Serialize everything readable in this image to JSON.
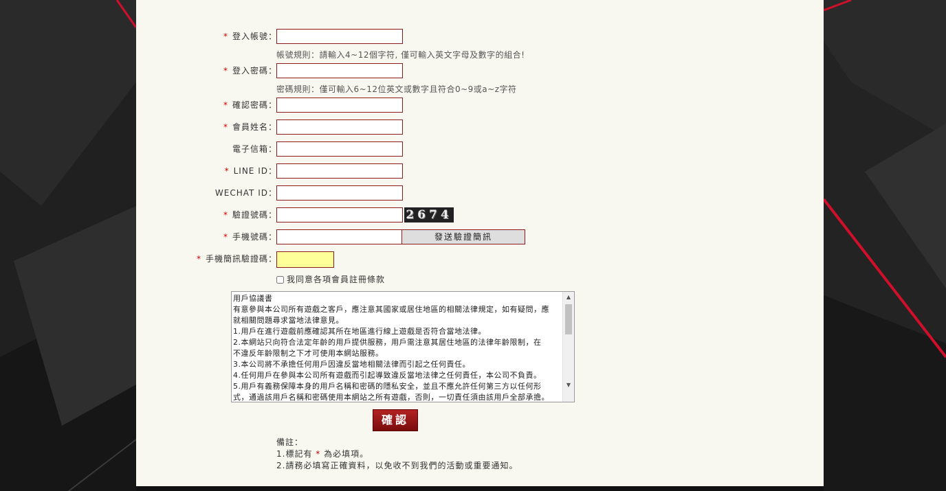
{
  "form": {
    "fields": [
      {
        "label": "登入帳號",
        "required": true,
        "value": ""
      },
      {
        "label": "登入密碼",
        "required": true,
        "value": ""
      },
      {
        "label": "確認密碼",
        "required": true,
        "value": ""
      },
      {
        "label": "會員姓名",
        "required": true,
        "value": ""
      },
      {
        "label": "電子信箱",
        "required": false,
        "value": ""
      },
      {
        "label": "LINE ID",
        "required": true,
        "value": ""
      },
      {
        "label": "WECHAT ID",
        "required": false,
        "value": ""
      },
      {
        "label": "驗證號碼",
        "required": true,
        "value": ""
      },
      {
        "label": "手機號碼",
        "required": true,
        "value": ""
      },
      {
        "label": "手機簡訊驗證碼",
        "required": true,
        "value": ""
      }
    ],
    "colon": "：",
    "required_mark": "*",
    "account_hint": "帳號規則：請輸入4~12個字符, 僅可輸入英文字母及數字的組合!",
    "password_hint": "密碼規則：僅可輸入6~12位英文或數字且符合0~9或a~z字符",
    "captcha_text": "2674",
    "send_sms_label": "發送驗證簡訊",
    "agree_label": "我同意各項會員註冊條款",
    "agree_checked": false,
    "terms_lines": [
      "用戶協議書",
      "有意參與本公司所有遊戲之客戶，應注意其國家或居住地區的相關法律規定，如有疑問，應",
      "就相關問題尋求當地法律意見。",
      "1.用戶在進行遊戲前應確認其所在地區進行線上遊戲是否符合當地法律。",
      "2.本網站只向符合法定年齡的用戶提供服務，用戶需注意其居住地區的法律年齡限制，在",
      "不違反年齡限制之下才可使用本網站服務。",
      "3.本公司將不承擔任何用戶因違反當地相關法律而引起之任何責任。",
      "4.任何用戶在參與本公司所有遊戲而引起導致違反當地法律之任何責任，本公司不負責。",
      "5.用戶有義務保障本身的用戶名稱和密碼的隱私安全，並且不應允許任何第三方以任何形",
      "式，通過該用戶名稱和密碼使用本網站之所有遊戲，否則，一切責任須由該用戶全部承擔。"
    ],
    "confirm_label": "確認",
    "notes_title": "備註：",
    "note1_prefix": "1.標記有",
    "note1_suffix": "為必填項。",
    "note2": "2.請務必填寫正確資料，以免收不到我們的活動或重要通知。"
  },
  "colors": {
    "accent": "#8b1a1a",
    "required": "#cc0000",
    "panel_bg": "#f8f8f0",
    "sms_code_bg": "#ffff99"
  }
}
